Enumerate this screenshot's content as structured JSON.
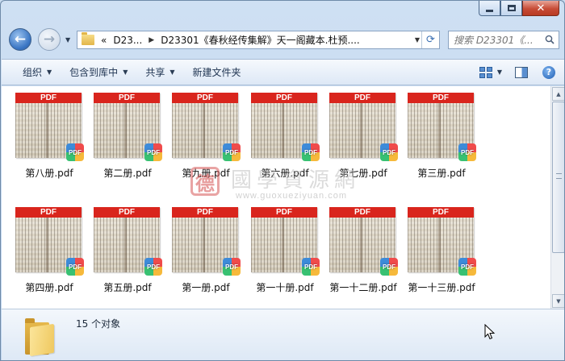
{
  "window": {
    "minimize_glyph": "",
    "close_glyph": "✕"
  },
  "nav": {
    "back_glyph": "←",
    "forward_glyph": "→",
    "dropdown_glyph": "▼"
  },
  "address": {
    "chevrons": "«",
    "crumbs": [
      "D23...",
      "D23301《春秋经传集解》天一阁藏本.杜预...."
    ],
    "separator": "▶",
    "dropdown_glyph": "▼",
    "refresh_glyph": "⟳"
  },
  "search": {
    "placeholder": "搜索 D23301《..."
  },
  "toolbar": {
    "organize": "组织",
    "include_library": "包含到库中",
    "share": "共享",
    "new_folder": "新建文件夹",
    "dropdown_glyph": "▼",
    "help_glyph": "?"
  },
  "files": [
    {
      "name": "第八册.pdf"
    },
    {
      "name": "第二册.pdf"
    },
    {
      "name": "第九册.pdf"
    },
    {
      "name": "第六册.pdf"
    },
    {
      "name": "第七册.pdf"
    },
    {
      "name": "第三册.pdf"
    },
    {
      "name": "第四册.pdf"
    },
    {
      "name": "第五册.pdf"
    },
    {
      "name": "第一册.pdf"
    },
    {
      "name": "第一十册.pdf"
    },
    {
      "name": "第一十二册.pdf"
    },
    {
      "name": "第一十三册.pdf"
    }
  ],
  "thumb": {
    "banner": "PDF",
    "badge": "PDF"
  },
  "watermark": {
    "seal": "德",
    "chinese": "國學資源網",
    "url": "www.guoxueziyuan.com"
  },
  "scrollbar": {
    "up_glyph": "▲",
    "down_glyph": "▼"
  },
  "details": {
    "count_text": "15 个对象"
  },
  "colors": {
    "pdf_red": "#d9251d",
    "window_frame": "#cfe0f3",
    "toolbar": "#dde8f6"
  }
}
